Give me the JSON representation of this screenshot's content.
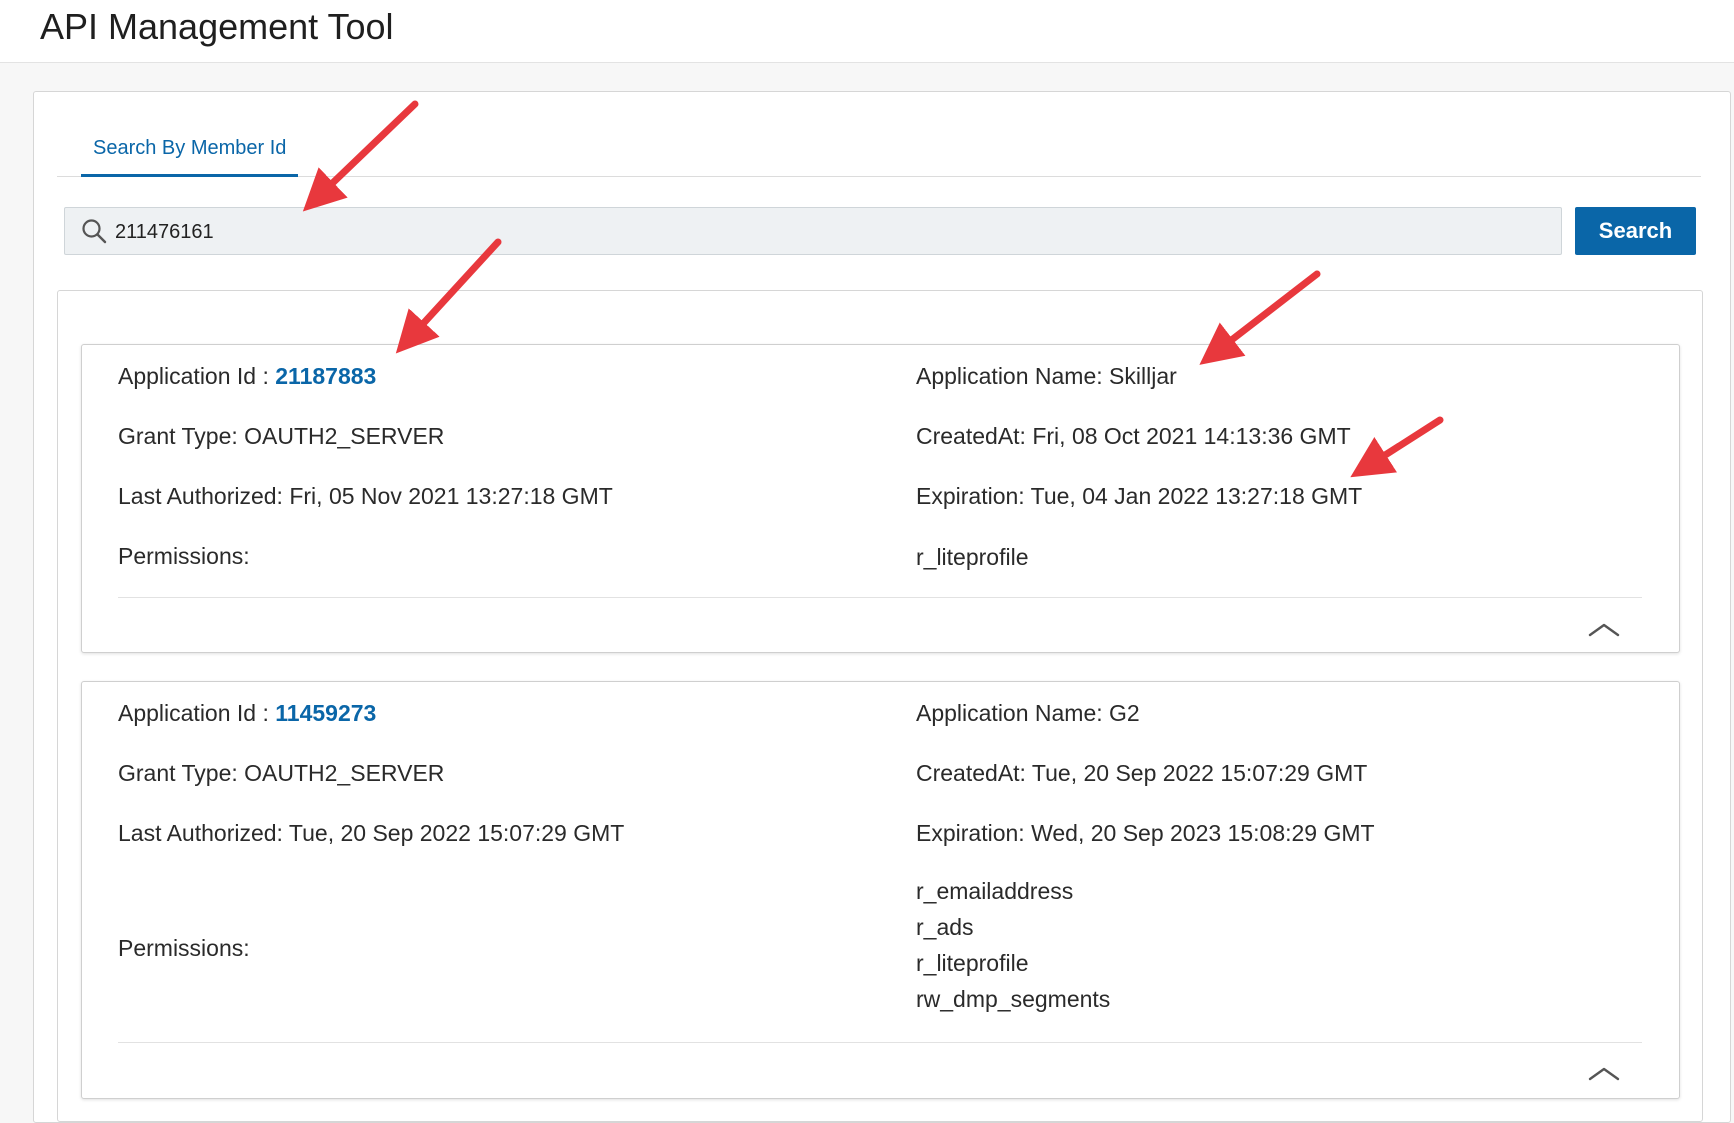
{
  "header": {
    "title": "API Management Tool"
  },
  "tabs": [
    {
      "label": "Search By Member Id",
      "active": true
    }
  ],
  "search": {
    "value": "211476161",
    "button_label": "Search"
  },
  "accent_color": "#0a66a8",
  "annotation_color": "#e8383d",
  "applications": [
    {
      "id_label": "Application Id : ",
      "id": "21187883",
      "name_label": "Application Name: ",
      "name": "Skilljar",
      "grant_label": "Grant Type: ",
      "grant_type": "OAUTH2_SERVER",
      "created_label": "CreatedAt: ",
      "created_at": "Fri, 08 Oct 2021 14:13:36 GMT",
      "authorized_label": "Last Authorized: ",
      "last_authorized": "Fri, 05 Nov 2021 13:27:18 GMT",
      "expiration_label": "Expiration: ",
      "expiration": "Tue, 04 Jan 2022 13:27:18 GMT",
      "permissions_label": "Permissions:",
      "permissions": [
        "r_liteprofile"
      ]
    },
    {
      "id_label": "Application Id : ",
      "id": "11459273",
      "name_label": "Application Name: ",
      "name": "G2",
      "grant_label": "Grant Type: ",
      "grant_type": "OAUTH2_SERVER",
      "created_label": "CreatedAt: ",
      "created_at": "Tue, 20 Sep 2022 15:07:29 GMT",
      "authorized_label": "Last Authorized: ",
      "last_authorized": "Tue, 20 Sep 2022 15:07:29 GMT",
      "expiration_label": "Expiration: ",
      "expiration": "Wed, 20 Sep 2023 15:08:29 GMT",
      "permissions_label": "Permissions:",
      "permissions": [
        "r_emailaddress",
        "r_ads",
        "r_liteprofile",
        "rw_dmp_segments"
      ]
    }
  ]
}
